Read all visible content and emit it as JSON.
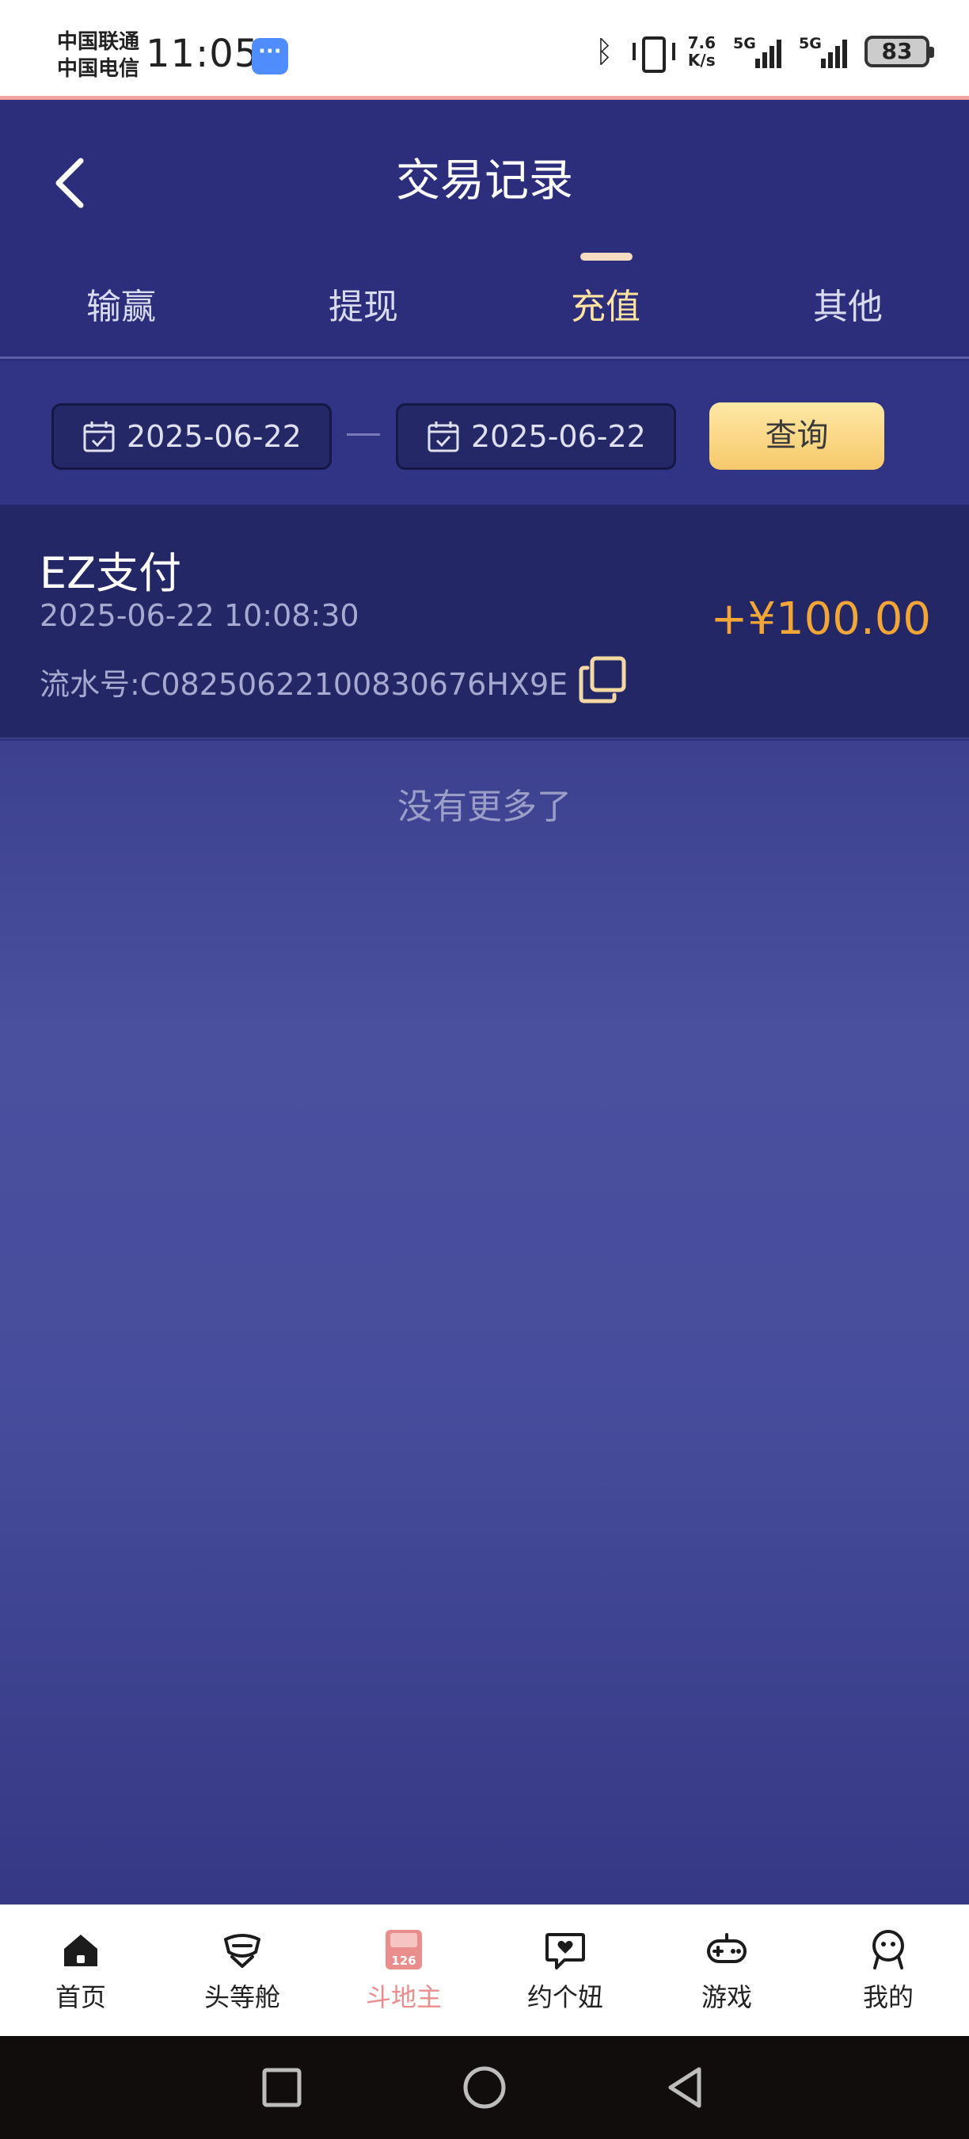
{
  "status_bar": {
    "carrier_1": "中国联通",
    "carrier_2": "中国电信",
    "time": "11:05",
    "net_speed_value": "7.6",
    "net_speed_unit": "K/s",
    "signal_1": "5G",
    "signal_2": "5G",
    "battery": "83"
  },
  "header": {
    "title": "交易记录"
  },
  "tabs": [
    {
      "label": "输赢"
    },
    {
      "label": "提现"
    },
    {
      "label": "充值"
    },
    {
      "label": "其他"
    }
  ],
  "active_tab": 2,
  "filter": {
    "start_date": "2025-06-22",
    "end_date": "2025-06-22",
    "query_label": "查询"
  },
  "records": [
    {
      "title": "EZ支付",
      "time": "2025-06-22 10:08:30",
      "serial": "流水号:C08250622100830676HX9E",
      "amount": "+¥100.00"
    }
  ],
  "footer_text": "没有更多了",
  "bottom_nav": [
    {
      "label": "首页",
      "icon": "home-icon"
    },
    {
      "label": "头等舱",
      "icon": "first-class-icon"
    },
    {
      "label": "斗地主",
      "icon": "doudizhu-icon",
      "badge": "126"
    },
    {
      "label": "约个妞",
      "icon": "heart-chat-icon"
    },
    {
      "label": "游戏",
      "icon": "gamepad-icon"
    },
    {
      "label": "我的",
      "icon": "profile-icon"
    }
  ],
  "active_nav": 2,
  "colors": {
    "accent_gold": "#ffe4a1",
    "amount": "#f2a638",
    "header_bg": "#2c2e7c",
    "active_nav": "#e98d8d"
  }
}
